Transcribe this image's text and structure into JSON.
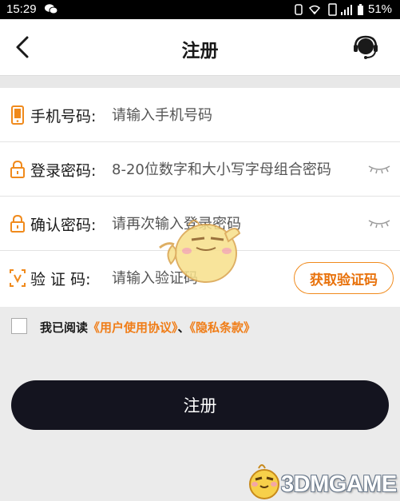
{
  "status_bar": {
    "time": "15:29",
    "battery": "51%"
  },
  "header": {
    "title": "注册"
  },
  "form": {
    "phone": {
      "label": "手机号码:",
      "placeholder": "请输入手机号码"
    },
    "password": {
      "label": "登录密码:",
      "placeholder": "8-20位数字和大小写字母组合密码"
    },
    "confirm": {
      "label": "确认密码:",
      "placeholder": "请再次输入登录密码"
    },
    "code": {
      "label": "验 证 码:",
      "placeholder": "请输入验证码",
      "button": "获取验证码"
    }
  },
  "agreement": {
    "prefix": "我已阅读",
    "link1": "《用户使用协议》",
    "sep": "、",
    "link2": "《隐私条款》"
  },
  "submit_label": "注册",
  "watermark": {
    "text": "3DMGAME"
  },
  "colors": {
    "accent": "#f08a1c",
    "button_bg": "#14141f"
  }
}
